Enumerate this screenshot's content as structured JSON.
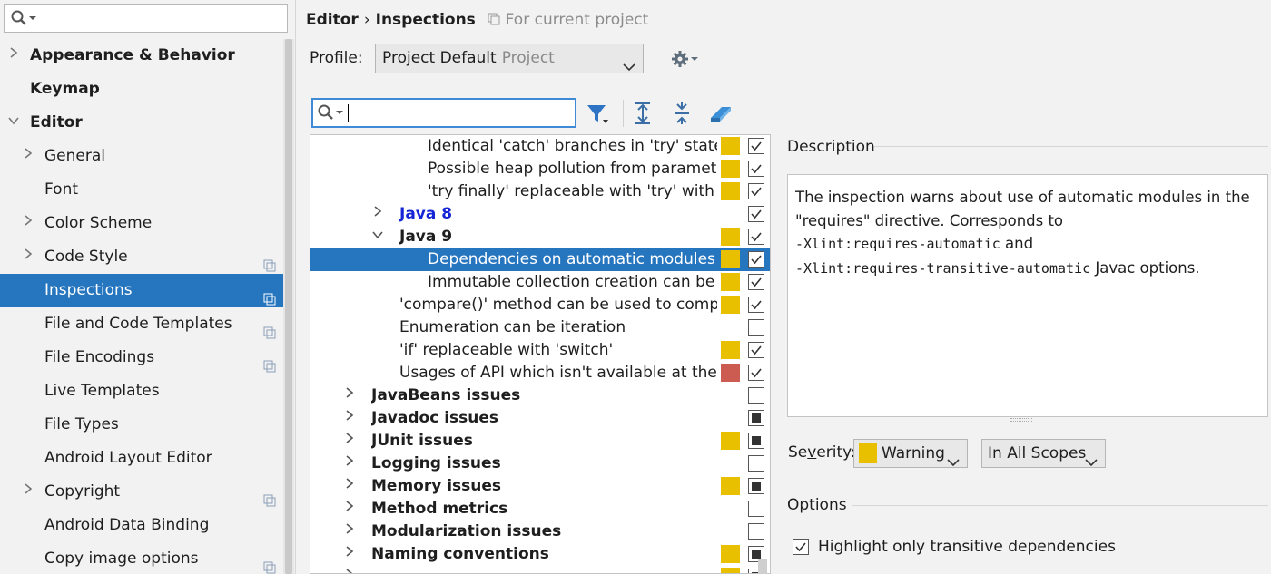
{
  "sidebar": {
    "search": {
      "value": "",
      "placeholder": ""
    },
    "items": [
      {
        "label": "Appearance & Behavior",
        "bold": true,
        "chevron": "right",
        "indent": 0,
        "copy": false,
        "selected": false
      },
      {
        "label": "Keymap",
        "bold": true,
        "chevron": null,
        "indent": 0,
        "copy": false,
        "selected": false
      },
      {
        "label": "Editor",
        "bold": true,
        "chevron": "down",
        "indent": 0,
        "copy": false,
        "selected": false
      },
      {
        "label": "General",
        "bold": false,
        "chevron": "right",
        "indent": 1,
        "copy": false,
        "selected": false
      },
      {
        "label": "Font",
        "bold": false,
        "chevron": null,
        "indent": 1,
        "copy": false,
        "selected": false
      },
      {
        "label": "Color Scheme",
        "bold": false,
        "chevron": "right",
        "indent": 1,
        "copy": false,
        "selected": false
      },
      {
        "label": "Code Style",
        "bold": false,
        "chevron": "right",
        "indent": 1,
        "copy": true,
        "selected": false
      },
      {
        "label": "Inspections",
        "bold": false,
        "chevron": null,
        "indent": 1,
        "copy": true,
        "selected": true
      },
      {
        "label": "File and Code Templates",
        "bold": false,
        "chevron": null,
        "indent": 1,
        "copy": true,
        "selected": false
      },
      {
        "label": "File Encodings",
        "bold": false,
        "chevron": null,
        "indent": 1,
        "copy": true,
        "selected": false
      },
      {
        "label": "Live Templates",
        "bold": false,
        "chevron": null,
        "indent": 1,
        "copy": false,
        "selected": false
      },
      {
        "label": "File Types",
        "bold": false,
        "chevron": null,
        "indent": 1,
        "copy": false,
        "selected": false
      },
      {
        "label": "Android Layout Editor",
        "bold": false,
        "chevron": null,
        "indent": 1,
        "copy": false,
        "selected": false
      },
      {
        "label": "Copyright",
        "bold": false,
        "chevron": "right",
        "indent": 1,
        "copy": true,
        "selected": false
      },
      {
        "label": "Android Data Binding",
        "bold": false,
        "chevron": null,
        "indent": 1,
        "copy": false,
        "selected": false
      },
      {
        "label": "Copy image options",
        "bold": false,
        "chevron": null,
        "indent": 1,
        "copy": true,
        "selected": false
      }
    ]
  },
  "breadcrumb": {
    "parent": "Editor",
    "separator": "›",
    "current": "Inspections",
    "scope": "For current project"
  },
  "profile": {
    "label": "Profile:",
    "value": "Project Default",
    "sub": "Project"
  },
  "tree_search": {
    "value": ""
  },
  "colors": {
    "warning": "#e8c000",
    "error": "#cc5b52",
    "selection": "#2675bf",
    "link": "#1525d6"
  },
  "tree": {
    "rows": [
      {
        "text": "Identical 'catch' branches in 'try' stateme",
        "level": 3,
        "chevron": null,
        "group": false,
        "sev": "warning",
        "check": "checked",
        "selected": false,
        "blue": false
      },
      {
        "text": "Possible heap pollution from parameteri",
        "level": 3,
        "chevron": null,
        "group": false,
        "sev": "warning",
        "check": "checked",
        "selected": false,
        "blue": false
      },
      {
        "text": "'try finally' replaceable with 'try' with reso",
        "level": 3,
        "chevron": null,
        "group": false,
        "sev": "warning",
        "check": "checked",
        "selected": false,
        "blue": false
      },
      {
        "text": "Java 8",
        "level": 2,
        "chevron": "right",
        "group": true,
        "sev": null,
        "check": "checked",
        "selected": false,
        "blue": true
      },
      {
        "text": "Java 9",
        "level": 2,
        "chevron": "down",
        "group": true,
        "sev": "warning",
        "check": "checked",
        "selected": false,
        "blue": false
      },
      {
        "text": "Dependencies on automatic modules",
        "level": 3,
        "chevron": null,
        "group": false,
        "sev": "warning",
        "check": "checked",
        "selected": true,
        "blue": false
      },
      {
        "text": "Immutable collection creation can be rep",
        "level": 3,
        "chevron": null,
        "group": false,
        "sev": "warning",
        "check": "checked",
        "selected": false,
        "blue": false
      },
      {
        "text": "'compare()' method can be used to compare",
        "level": 2,
        "chevron": null,
        "group": false,
        "sev": "warning",
        "check": "checked",
        "selected": false,
        "blue": false
      },
      {
        "text": "Enumeration can be iteration",
        "level": 2,
        "chevron": null,
        "group": false,
        "sev": null,
        "check": "unchecked",
        "selected": false,
        "blue": false
      },
      {
        "text": "'if' replaceable with 'switch'",
        "level": 2,
        "chevron": null,
        "group": false,
        "sev": "warning",
        "check": "checked",
        "selected": false,
        "blue": false
      },
      {
        "text": "Usages of API which isn't available at the cor",
        "level": 2,
        "chevron": null,
        "group": false,
        "sev": "error",
        "check": "checked",
        "selected": false,
        "blue": false
      },
      {
        "text": "JavaBeans issues",
        "level": 1,
        "chevron": "right",
        "group": true,
        "sev": null,
        "check": "unchecked",
        "selected": false,
        "blue": false
      },
      {
        "text": "Javadoc issues",
        "level": 1,
        "chevron": "right",
        "group": true,
        "sev": null,
        "check": "partial",
        "selected": false,
        "blue": false
      },
      {
        "text": "JUnit issues",
        "level": 1,
        "chevron": "right",
        "group": true,
        "sev": "warning",
        "check": "partial",
        "selected": false,
        "blue": false
      },
      {
        "text": "Logging issues",
        "level": 1,
        "chevron": "right",
        "group": true,
        "sev": null,
        "check": "unchecked",
        "selected": false,
        "blue": false
      },
      {
        "text": "Memory issues",
        "level": 1,
        "chevron": "right",
        "group": true,
        "sev": "warning",
        "check": "partial",
        "selected": false,
        "blue": false
      },
      {
        "text": "Method metrics",
        "level": 1,
        "chevron": "right",
        "group": true,
        "sev": null,
        "check": "unchecked",
        "selected": false,
        "blue": false
      },
      {
        "text": "Modularization issues",
        "level": 1,
        "chevron": "right",
        "group": true,
        "sev": null,
        "check": "unchecked",
        "selected": false,
        "blue": false
      },
      {
        "text": "Naming conventions",
        "level": 1,
        "chevron": "right",
        "group": true,
        "sev": "warning",
        "check": "partial",
        "selected": false,
        "blue": false
      },
      {
        "text": "",
        "level": 1,
        "chevron": "right",
        "group": true,
        "sev": "warning",
        "check": "partial",
        "selected": false,
        "blue": false
      }
    ]
  },
  "description": {
    "title": "Description",
    "text1": "The inspection warns about use of automatic modules in the \"requires\" directive. Corresponds to",
    "code1": "-Xlint:requires-automatic",
    "text2": "and",
    "code2": "-Xlint:requires-transitive-automatic",
    "text3": "Javac options."
  },
  "severity": {
    "label_pre": "Se",
    "label_mnemonic": "v",
    "label_post": "erity:",
    "value": "Warning",
    "scope": "In All Scopes"
  },
  "options": {
    "title": "Options",
    "checkbox_label": "Highlight only transitive dependencies",
    "checked": true
  }
}
